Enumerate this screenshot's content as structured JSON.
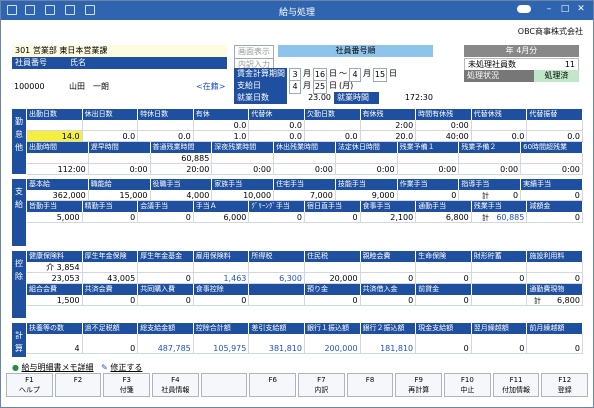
{
  "title": "給与処理",
  "company": "OBC商事株式会社",
  "header": {
    "dept_code": "301",
    "dept_name": "営業部 東日本営業課",
    "emp_code_label": "社員番号",
    "name_label": "氏名",
    "emp_code": "100000",
    "emp_name": "山田　一朗",
    "status": "<在籍>",
    "btn_order": "画面表示",
    "btn_input": "内訳入力",
    "sort_label": "社員番号順",
    "period_label": "賃金計算期間",
    "period": [
      "3",
      "月",
      "16",
      "日",
      "～",
      "4",
      "月",
      "15",
      "日"
    ],
    "pay_label": "支給日",
    "pay": [
      "4",
      "月",
      "25",
      "日",
      "(月)"
    ],
    "workdays_label": "就業日数",
    "workdays": "23.00",
    "worktime_label": "就業時間",
    "worktime": "172:30",
    "month": "年 4月分",
    "unprocessed_label": "未処理社員数",
    "unprocessed": "11",
    "status_label": "処理状況",
    "status_value": "処理済"
  },
  "kintai": {
    "side": "勤怠他",
    "h1": [
      "出勤日数",
      "休出日数",
      "特休日数",
      "有休",
      "代替休",
      "欠勤日数",
      "有休残",
      "時間有休残",
      "代替休残",
      "代替振替"
    ],
    "v1": [
      "14.0",
      "0.0",
      "0.0",
      "1.0",
      "0.0",
      "0.0",
      "20.0",
      "40:00",
      "0.0",
      "0.0"
    ],
    "v1b": [
      "",
      "",
      "",
      "0.0",
      "0.0",
      "",
      "2:00",
      "0:00",
      "",
      ""
    ],
    "h2": [
      "出勤時間",
      "遅早時間",
      "普通残業時間",
      "深夜残業時間",
      "休出残業時間",
      "法定休日時間",
      "残業予備１",
      "残業予備２",
      "60時間超残業"
    ],
    "v2a": [
      "",
      "",
      "60,885",
      "",
      "",
      "",
      "",
      "",
      ""
    ],
    "v2": [
      "112:00",
      "0:00",
      "20:00",
      "0:00",
      "0:00",
      "0:00",
      "0:00",
      "0:00",
      "0:00"
    ]
  },
  "shikyu": {
    "side": "支給",
    "h1": [
      "基本給",
      "職能給",
      "役職手当",
      "家族手当",
      "住宅手当",
      "技能手当",
      "作業手当",
      "指導手当",
      "実績手当"
    ],
    "v1": [
      "362,000",
      "15,000",
      "4,000",
      "10,000",
      "7,000",
      "9,000",
      "0",
      "0",
      "0"
    ],
    "h2": [
      "皆勤手当",
      "精勤手当",
      "会議手当",
      "手当Ａ",
      "ｸﾞﾘｰﾝｸﾞ手当",
      "宿日直手当",
      "食事手当",
      "通勤手当",
      "残業手当",
      "減額金"
    ],
    "v2": [
      "5,000",
      "0",
      "0",
      "6,000",
      "0",
      "0",
      "2,100",
      "6,800",
      "60,885",
      "0"
    ],
    "kei": "計"
  },
  "kojo": {
    "side": "控除",
    "h1": [
      "健康保険料",
      "厚生年金保険",
      "厚生年金基金",
      "雇用保険料",
      "所得税",
      "住民税",
      "親睦会費",
      "生命保険",
      "財形貯蓄",
      "施設利用料"
    ],
    "v1a": [
      "介  3,854",
      "",
      "",
      "",
      "",
      "",
      "",
      "",
      "",
      ""
    ],
    "v1": [
      "23,053",
      "43,005",
      "0",
      "1,463",
      "6,300",
      "20,000",
      "0",
      "0",
      "0",
      "0"
    ],
    "h2": [
      "組合会費",
      "共済会費",
      "共同購入費",
      "食事控除",
      "",
      "預り金",
      "共済借入金",
      "前貸金",
      "",
      "通勤費現物"
    ],
    "v2": [
      "1,500",
      "0",
      "0",
      "0",
      "",
      "0",
      "0",
      "0",
      "",
      "6,800"
    ],
    "kei": "計"
  },
  "keisan": {
    "side": "計算",
    "h": [
      "扶養等の数",
      "過不足税額",
      "総支給金額",
      "控除合計額",
      "差引支給額",
      "銀行１振込額",
      "銀行２振込額",
      "現金支給額",
      "翌月繰越額",
      "前月繰越額"
    ],
    "v": [
      "4",
      "0",
      "487,785",
      "105,975",
      "381,810",
      "200,000",
      "181,810",
      "0",
      "0",
      "0"
    ]
  },
  "links": [
    "給与明細書メモ詳細",
    "修正する"
  ],
  "fkeys": [
    {
      "k": "F1",
      "l": "ヘルプ"
    },
    {
      "k": "F2",
      "l": ""
    },
    {
      "k": "F3",
      "l": "付箋"
    },
    {
      "k": "F4",
      "l": "社員情報"
    },
    {
      "k": "",
      "l": ""
    },
    {
      "k": "F6",
      "l": ""
    },
    {
      "k": "F7",
      "l": "内訳"
    },
    {
      "k": "F8",
      "l": ""
    },
    {
      "k": "F9",
      "l": "再計算"
    },
    {
      "k": "F10",
      "l": "中止"
    },
    {
      "k": "F11",
      "l": "付加情報"
    },
    {
      "k": "F12",
      "l": "登録"
    }
  ]
}
